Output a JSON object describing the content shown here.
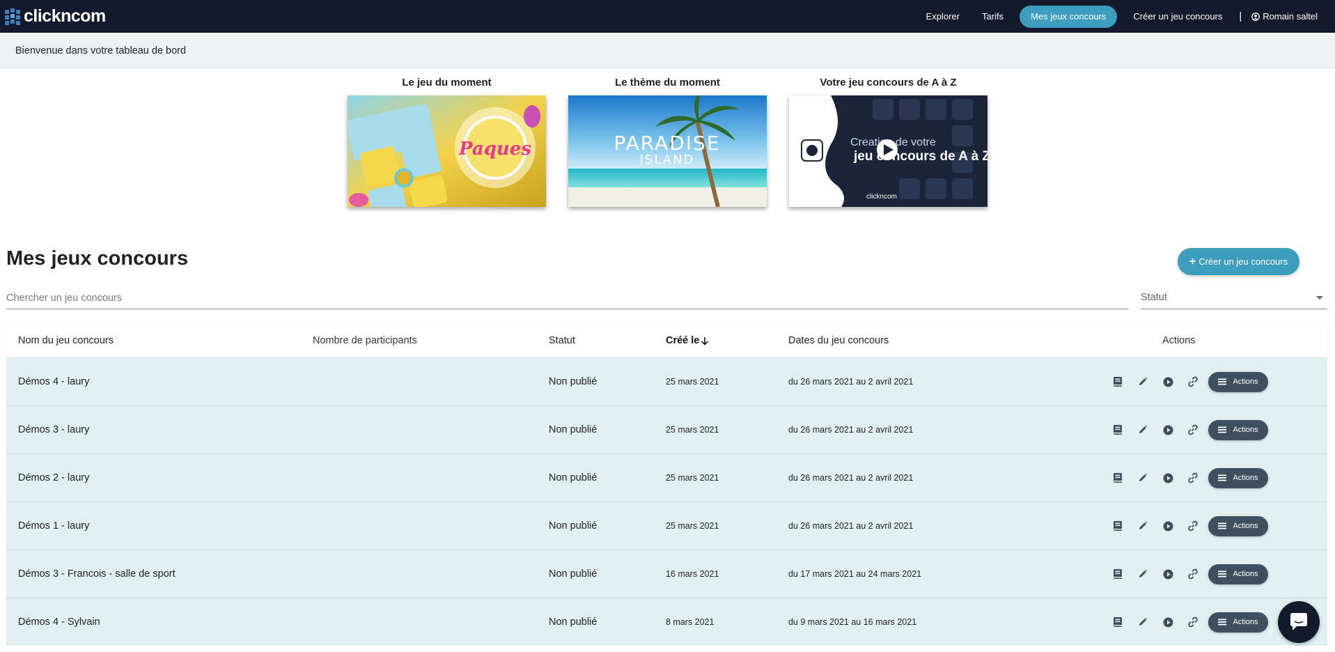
{
  "brand": {
    "logo_text": "clickncom"
  },
  "nav": {
    "items": [
      {
        "label": "Explorer"
      },
      {
        "label": "Tarifs"
      },
      {
        "label": "Mes jeux concours"
      },
      {
        "label": "Créer un jeu concours"
      }
    ],
    "separator": "|",
    "user_name": "Romain saltel"
  },
  "welcome": "Bienvenue dans votre tableau de bord",
  "featured": [
    {
      "title": "Le jeu du moment",
      "image_text": "Paques"
    },
    {
      "title": "Le thème du moment",
      "image_text_1": "PARADISE",
      "image_text_2": "ISLAND"
    },
    {
      "title": "Votre jeu concours de A à Z",
      "image_text_1": "Creation de votre",
      "image_text_2": "jeu concours de A à Z",
      "image_brand": "clickncom"
    }
  ],
  "section": {
    "title": "Mes jeux concours",
    "create_label": "Créer un jeu concours",
    "search_placeholder": "Chercher un jeu concours",
    "status_placeholder": "Statut"
  },
  "table": {
    "headers": {
      "name": "Nom du jeu concours",
      "participants": "Nombre de participants",
      "status": "Statut",
      "created": "Créé le",
      "dates": "Dates du jeu concours",
      "actions": "Actions"
    },
    "rows": [
      {
        "name": "Démos 4 - laury",
        "participants": "",
        "status": "Non publié",
        "created": "25 mars 2021",
        "dates": "du 26 mars 2021 au 2 avril 2021",
        "action_label": "Actions"
      },
      {
        "name": "Démos 3 - laury",
        "participants": "",
        "status": "Non publié",
        "created": "25 mars 2021",
        "dates": "du 26 mars 2021 au 2 avril 2021",
        "action_label": "Actions"
      },
      {
        "name": "Démos 2 - laury",
        "participants": "",
        "status": "Non publié",
        "created": "25 mars 2021",
        "dates": "du 26 mars 2021 au 2 avril 2021",
        "action_label": "Actions"
      },
      {
        "name": "Démos 1 - laury",
        "participants": "",
        "status": "Non publié",
        "created": "25 mars 2021",
        "dates": "du 26 mars 2021 au 2 avril 2021",
        "action_label": "Actions"
      },
      {
        "name": "Démos 3 - Francois - salle de sport",
        "participants": "",
        "status": "Non publié",
        "created": "16 mars 2021",
        "dates": "du 17 mars 2021 au 24 mars 2021",
        "action_label": "Actions"
      },
      {
        "name": "Démos 4 - Sylvain",
        "participants": "",
        "status": "Non publié",
        "created": "8 mars 2021",
        "dates": "du 9 mars 2021 au 16 mars 2021",
        "action_label": "Actions"
      }
    ]
  },
  "colors": {
    "nav_bg": "#141a2e",
    "accent": "#3d9dbf",
    "row_bg": "#e1eff0",
    "action_btn": "#3e5060"
  },
  "icons": [
    "cube-logo-icon",
    "user-icon",
    "plus-icon",
    "sort-down-icon",
    "book-icon",
    "pencil-icon",
    "play-icon",
    "link-icon",
    "menu-icon",
    "chat-icon",
    "caret-down-icon"
  ]
}
